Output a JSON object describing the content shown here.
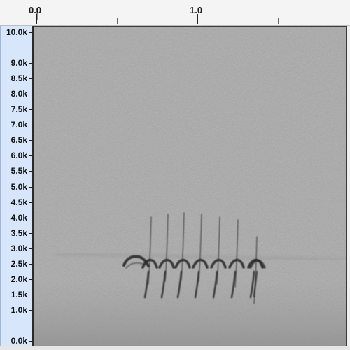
{
  "time_axis": {
    "labels": [
      {
        "text": "0.0",
        "seconds": 0.0
      },
      {
        "text": "1.0",
        "seconds": 1.0
      }
    ]
  },
  "freq_axis": {
    "labels": [
      {
        "text": "10.0k",
        "khz": 10.0
      },
      {
        "text": "9.0k",
        "khz": 9.0
      },
      {
        "text": "8.5k",
        "khz": 8.5
      },
      {
        "text": "8.0k",
        "khz": 8.0
      },
      {
        "text": "7.5k",
        "khz": 7.5
      },
      {
        "text": "7.0k",
        "khz": 7.0
      },
      {
        "text": "6.5k",
        "khz": 6.5
      },
      {
        "text": "6.0k",
        "khz": 6.0
      },
      {
        "text": "5.5k",
        "khz": 5.5
      },
      {
        "text": "5.0k",
        "khz": 5.0
      },
      {
        "text": "4.5k",
        "khz": 4.5
      },
      {
        "text": "4.0k",
        "khz": 4.0
      },
      {
        "text": "3.5k",
        "khz": 3.5
      },
      {
        "text": "3.0k",
        "khz": 3.0
      },
      {
        "text": "2.5k",
        "khz": 2.5
      },
      {
        "text": "2.0k",
        "khz": 2.0
      },
      {
        "text": "1.5k",
        "khz": 1.5
      },
      {
        "text": "1.0k",
        "khz": 1.0
      },
      {
        "text": "0.0k",
        "khz": 0.0
      }
    ]
  },
  "colors": {
    "axis_background": "#d7e6fb",
    "spectrogram_background": "#a6a6a6",
    "call_trace": "#262626"
  }
}
